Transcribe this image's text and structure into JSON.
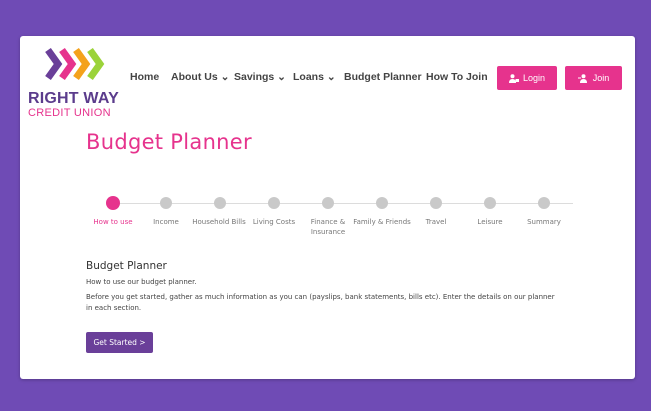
{
  "brand": {
    "line1": "RIGHT WAY",
    "line2": "CREDIT UNION",
    "colors": {
      "primary": "#e6338d",
      "purple": "#6f4bb5",
      "button_purple": "#6a3f99"
    }
  },
  "nav": {
    "items": [
      {
        "label": "Home"
      },
      {
        "label": "About Us ⌄"
      },
      {
        "label": "Savings ⌄"
      },
      {
        "label": "Loans ⌄"
      },
      {
        "label": "Budget Planner"
      },
      {
        "label": "How To Join"
      }
    ],
    "login_label": "Login",
    "join_label": "Join"
  },
  "page": {
    "title": "Budget Planner"
  },
  "steps": [
    {
      "label": "How to use",
      "active": true
    },
    {
      "label": "Income"
    },
    {
      "label": "Household Bills"
    },
    {
      "label": "Living Costs"
    },
    {
      "label": "Finance & Insurance"
    },
    {
      "label": "Family & Friends"
    },
    {
      "label": "Travel"
    },
    {
      "label": "Leisure"
    },
    {
      "label": "Summary"
    }
  ],
  "content": {
    "heading": "Budget Planner",
    "intro": "How to use our budget planner.",
    "body": "Before you get started, gather as much information as you can (payslips, bank statements, bills etc).  Enter the details on our planner in each section.",
    "button_label": "Get Started >"
  }
}
